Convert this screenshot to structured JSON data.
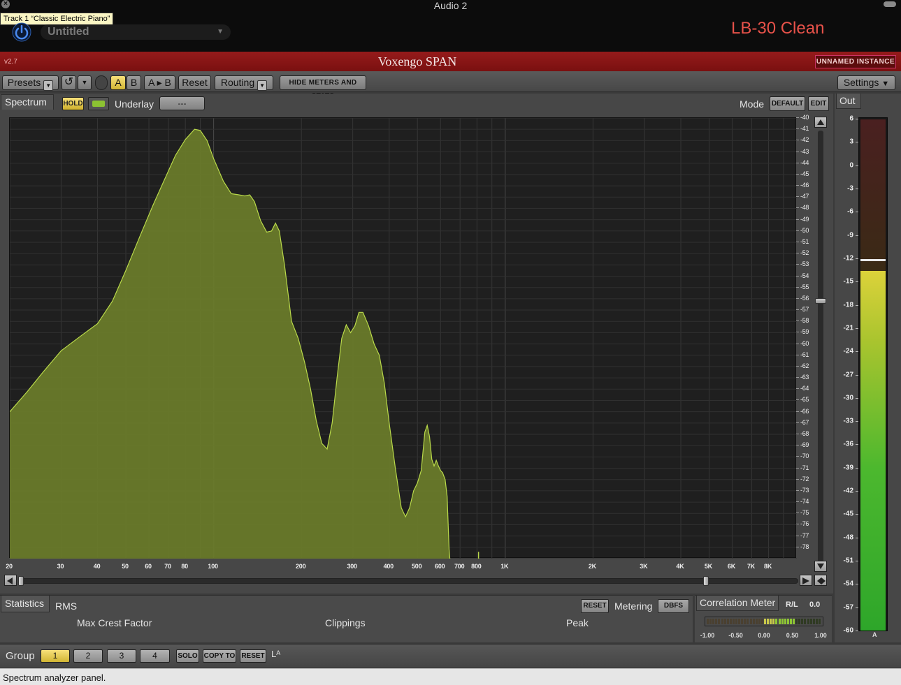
{
  "window": {
    "title": "Audio 2",
    "tooltip": "Track 1 “Classic Electric Piano”",
    "preset": "Untitled",
    "preset_name": "LB-30 Clean"
  },
  "plugin": {
    "version": "v2.7",
    "title": "Voxengo SPAN",
    "instance": "UNNAMED INSTANCE"
  },
  "toolbar": {
    "presets": "Presets",
    "a": "A",
    "b": "B",
    "ab": "A ▸ B",
    "reset": "Reset",
    "routing": "Routing",
    "hide_meters": "HIDE METERS AND STATS",
    "settings": "Settings"
  },
  "spectrum": {
    "tab": "Spectrum",
    "hold": "HOLD",
    "underlay_label": "Underlay",
    "underlay_value": "---",
    "mode_label": "Mode",
    "mode_default": "DEFAULT",
    "mode_edit": "EDIT",
    "db_labels": [
      "-40",
      "-41",
      "-42",
      "-43",
      "-44",
      "-45",
      "-46",
      "-47",
      "-48",
      "-49",
      "-50",
      "-51",
      "-52",
      "-53",
      "-54",
      "-55",
      "-56",
      "-57",
      "-58",
      "-59",
      "-60",
      "-61",
      "-62",
      "-63",
      "-64",
      "-65",
      "-66",
      "-67",
      "-68",
      "-69",
      "-70",
      "-71",
      "-72",
      "-73",
      "-74",
      "-75",
      "-76",
      "-77",
      "-78"
    ],
    "freq_labels": [
      {
        "f": 20,
        "t": "20"
      },
      {
        "f": 30,
        "t": "30"
      },
      {
        "f": 40,
        "t": "40"
      },
      {
        "f": 50,
        "t": "50"
      },
      {
        "f": 60,
        "t": "60"
      },
      {
        "f": 70,
        "t": "70"
      },
      {
        "f": 80,
        "t": "80"
      },
      {
        "f": 100,
        "t": "100"
      },
      {
        "f": 200,
        "t": "200"
      },
      {
        "f": 300,
        "t": "300"
      },
      {
        "f": 400,
        "t": "400"
      },
      {
        "f": 500,
        "t": "500"
      },
      {
        "f": 600,
        "t": "600"
      },
      {
        "f": 700,
        "t": "700"
      },
      {
        "f": 800,
        "t": "800"
      },
      {
        "f": 1000,
        "t": "1K"
      },
      {
        "f": 2000,
        "t": "2K"
      },
      {
        "f": 3000,
        "t": "3K"
      },
      {
        "f": 4000,
        "t": "4K"
      },
      {
        "f": 5000,
        "t": "5K"
      },
      {
        "f": 6000,
        "t": "6K"
      },
      {
        "f": 7000,
        "t": "7K"
      },
      {
        "f": 8000,
        "t": "8K"
      }
    ],
    "curve": [
      [
        20,
        -66
      ],
      [
        23,
        -64.2
      ],
      [
        26,
        -62.5
      ],
      [
        30,
        -60.6
      ],
      [
        35,
        -59.3
      ],
      [
        40,
        -58.2
      ],
      [
        45,
        -56.2
      ],
      [
        50,
        -53.5
      ],
      [
        56,
        -50.4
      ],
      [
        62,
        -47.7
      ],
      [
        68,
        -45.4
      ],
      [
        74,
        -43.3
      ],
      [
        80,
        -41.9
      ],
      [
        86,
        -41
      ],
      [
        90,
        -41.1
      ],
      [
        95,
        -42
      ],
      [
        100,
        -43.6
      ],
      [
        108,
        -45.6
      ],
      [
        115,
        -46.7
      ],
      [
        122,
        -46.8
      ],
      [
        128,
        -46.9
      ],
      [
        133,
        -46.8
      ],
      [
        138,
        -47.4
      ],
      [
        145,
        -49.1
      ],
      [
        152,
        -50.1
      ],
      [
        158,
        -50
      ],
      [
        163,
        -49.3
      ],
      [
        168,
        -50
      ],
      [
        175,
        -53
      ],
      [
        185,
        -58
      ],
      [
        195,
        -59.5
      ],
      [
        205,
        -61.6
      ],
      [
        215,
        -64
      ],
      [
        225,
        -66.8
      ],
      [
        235,
        -68.8
      ],
      [
        245,
        -69.3
      ],
      [
        255,
        -67
      ],
      [
        265,
        -63
      ],
      [
        275,
        -59.5
      ],
      [
        285,
        -58.3
      ],
      [
        295,
        -59
      ],
      [
        305,
        -58.4
      ],
      [
        315,
        -57.2
      ],
      [
        325,
        -57.2
      ],
      [
        340,
        -58.4
      ],
      [
        355,
        -60
      ],
      [
        370,
        -61
      ],
      [
        385,
        -63.5
      ],
      [
        400,
        -67
      ],
      [
        420,
        -71
      ],
      [
        440,
        -74.5
      ],
      [
        455,
        -75.3
      ],
      [
        470,
        -74.5
      ],
      [
        485,
        -73
      ],
      [
        500,
        -72.3
      ],
      [
        515,
        -71.2
      ],
      [
        530,
        -67.8
      ],
      [
        540,
        -67.2
      ],
      [
        550,
        -68.2
      ],
      [
        560,
        -70.2
      ],
      [
        570,
        -70.8
      ],
      [
        580,
        -70.3
      ],
      [
        590,
        -70.8
      ],
      [
        600,
        -71.2
      ],
      [
        610,
        -71.4
      ],
      [
        622,
        -72
      ],
      [
        632,
        -73.5
      ],
      [
        642,
        -78.2
      ],
      [
        646,
        -79
      ]
    ]
  },
  "statistics": {
    "tab": "Statistics",
    "rms": "RMS",
    "max_crest": "Max Crest Factor",
    "clippings": "Clippings",
    "peak": "Peak",
    "reset": "RESET",
    "metering_label": "Metering",
    "metering_value": "DBFS"
  },
  "correlation": {
    "title": "Correlation Meter",
    "rl": "R/L",
    "value": "0.0",
    "ticks": [
      "-1.00",
      "-0.50",
      "0.00",
      "0.50",
      "1.00"
    ]
  },
  "output": {
    "label": "Out",
    "scale": [
      "6",
      "3",
      "0",
      "-3",
      "-6",
      "-9",
      "-12",
      "-15",
      "-18",
      "-21",
      "-24",
      "-27",
      "-30",
      "-33",
      "-36",
      "-39",
      "-42",
      "-45",
      "-48",
      "-51",
      "-54",
      "-57",
      "-60"
    ],
    "level_db": -13.5,
    "peak_db": -12,
    "channel": "A"
  },
  "group": {
    "label": "Group",
    "buttons": [
      "1",
      "2",
      "3",
      "4"
    ],
    "solo": "SOLO",
    "copy_to": "COPY TO",
    "reset": "RESET",
    "la": "Lᴬ"
  },
  "status": "Spectrum analyzer panel.",
  "colors": {
    "spectrum_fill": "#6b7d2a",
    "spectrum_line": "#b9d94a",
    "plugin_bar": "#8a1515",
    "accent_yellow": "#e8cf50",
    "preset_name": "#e8524a"
  }
}
